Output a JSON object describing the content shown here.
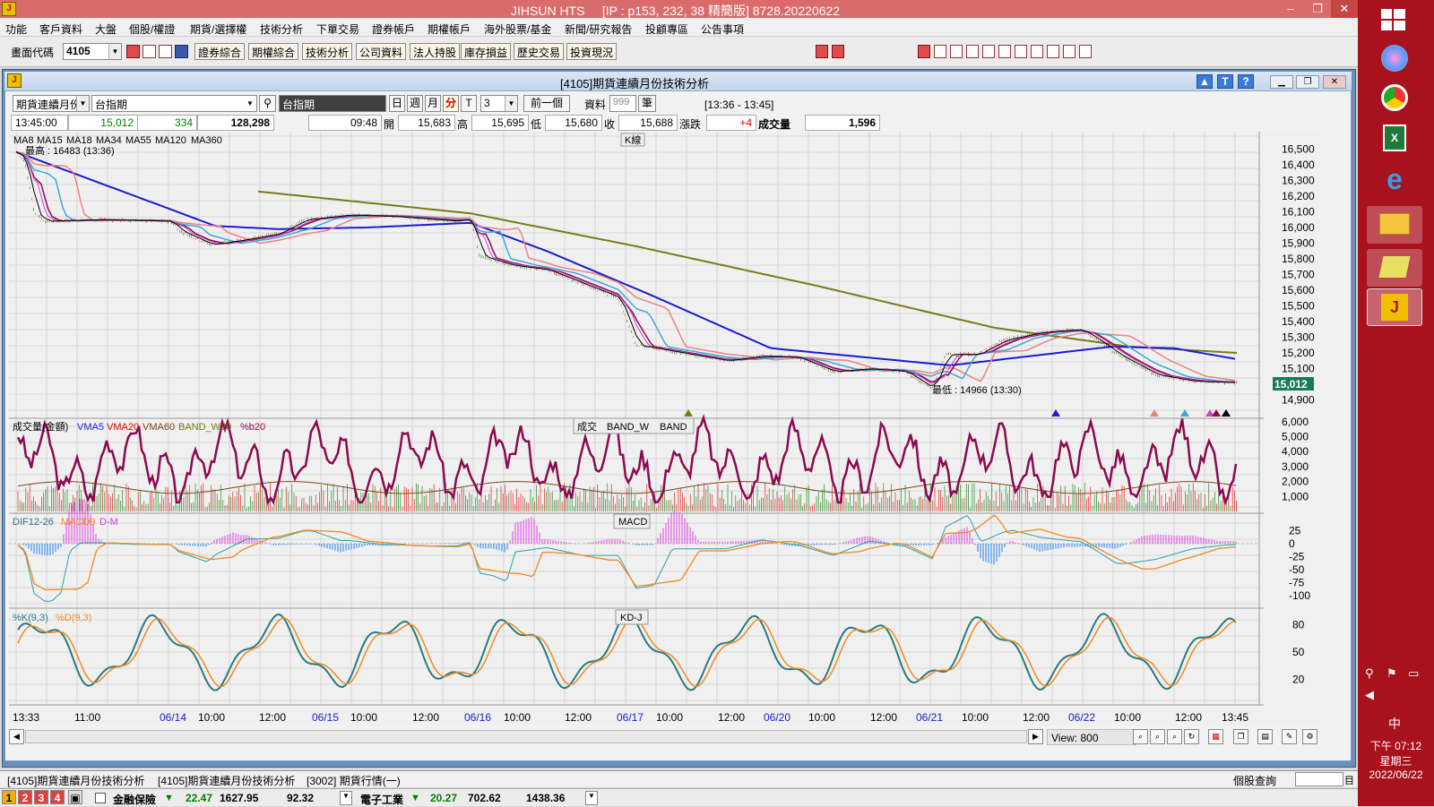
{
  "app": {
    "title": "JIHSUN HTS",
    "server_info": "[IP : p153, 232, 38 精簡版] 8728.20220622"
  },
  "menu": [
    "功能",
    "客戶資料",
    "大盤",
    "個股/權證",
    "期貨/選擇權",
    "技術分析",
    "下單交易",
    "證券帳戶",
    "期權帳戶",
    "海外股票/基金",
    "新聞/研究報告",
    "投顧專區",
    "公告事項"
  ],
  "toolbar": {
    "code_label": "畫面代碼",
    "code_value": "4105",
    "buttons": [
      "證券綜合",
      "期權綜合",
      "技術分析",
      "公司資料",
      "法人持股",
      "庫存損益",
      "歷史交易",
      "投資現況"
    ]
  },
  "window": {
    "title": "[4105]期貨連續月份技術分析"
  },
  "controls": {
    "contract_type": "期貨連續月份",
    "instrument": "台指期",
    "instrument_display": "台指期",
    "period_buttons": [
      "日",
      "週",
      "月",
      "分",
      "T"
    ],
    "active_period": "分",
    "interval": "3",
    "prev_button": "前一個",
    "data_label": "資料",
    "data_count": "999",
    "unit_label": "筆",
    "range": "[13:36 - 13:45]"
  },
  "quote": {
    "time": "13:45:00",
    "price": "15,012",
    "change": "334",
    "volume_total": "128,298",
    "bar_time": "09:48",
    "open_label": "開",
    "open": "15,683",
    "high_label": "高",
    "high": "15,695",
    "low_label": "低",
    "low": "15,680",
    "close_label": "收",
    "close": "15,688",
    "chg_label": "漲跌",
    "chg": "+4",
    "vol_label": "成交量",
    "vol": "1,596"
  },
  "colors": {
    "up": "#e00000",
    "down": "#008000",
    "ma8": "#000000",
    "ma15": "#cc44cc",
    "ma18": "#8b0a50",
    "ma34": "#3fa7d6",
    "ma55": "#f08080",
    "ma120": "#1c1cd0",
    "ma360": "#7a7a1a",
    "vol_line": "#8b0a50",
    "macd_pos": "#e040e0",
    "macd_neg": "#2080f0",
    "k_line": "#2a7a80",
    "d_line": "#f08a20"
  },
  "panels": {
    "kline": {
      "tag": "K線",
      "legend": [
        "MA8",
        "MA15",
        "MA18",
        "MA34",
        "MA55",
        "MA120",
        "MA360"
      ],
      "high_note": "最高 : 16483 (13:36)",
      "low_note": "最低 : 14966 (13:30)",
      "y_ticks": [
        "16,500",
        "16,400",
        "16,300",
        "16,200",
        "16,100",
        "16,000",
        "15,900",
        "15,800",
        "15,700",
        "15,600",
        "15,500",
        "15,400",
        "15,300",
        "15,200",
        "15,100",
        "15,000",
        "14,900"
      ],
      "last_price": "15,012"
    },
    "volume": {
      "tag_parts": [
        "成交",
        "BAND_W",
        "BAND"
      ],
      "legend": [
        "成交量(金額)",
        "VMA5",
        "VMA20",
        "VMA60",
        "BAND_W20",
        "%b20"
      ],
      "y_ticks": [
        "6,000",
        "5,000",
        "4,000",
        "3,000",
        "2,000",
        "1,000"
      ]
    },
    "macd": {
      "tag": "MACD",
      "legend": [
        "DIF12-26",
        "MACD9",
        "D-M"
      ],
      "y_ticks": [
        "25",
        "0",
        "-25",
        "-50",
        "-75",
        "-100"
      ]
    },
    "kd": {
      "tag": "KD-J",
      "legend": [
        "%K(9,3)",
        "%D(9,3)"
      ],
      "y_ticks": [
        "80",
        "50",
        "20"
      ]
    }
  },
  "x_axis": [
    "13:33",
    "11:00",
    "06/14",
    "10:00",
    "12:00",
    "06/15",
    "10:00",
    "12:00",
    "06/16",
    "10:00",
    "12:00",
    "06/17",
    "10:00",
    "12:00",
    "06/20",
    "10:00",
    "12:00",
    "06/21",
    "10:00",
    "12:00",
    "06/22",
    "10:00",
    "12:00",
    "13:45"
  ],
  "view": {
    "label": "View:",
    "value": "800"
  },
  "tabs": [
    "[4105]期貨連續月份技術分析",
    "[4105]期貨連續月份技術分析",
    "[3002] 期貨行情(一)"
  ],
  "status_bar": {
    "right_label": "個股查詢",
    "right_btn": "目",
    "nums": [
      "1",
      "2",
      "3",
      "4"
    ],
    "sector1": "金融保險",
    "sector1_chg": "22.47",
    "sector1_val": "1627.95",
    "sector1_vol": "92.32",
    "sector2": "電子工業",
    "sector2_chg": "20.27",
    "sector2_val": "702.62",
    "sector2_vol": "1438.36"
  },
  "taskbar": {
    "ime": "中",
    "time": "下午 07:12",
    "weekday": "星期三",
    "date": "2022/06/22"
  }
}
